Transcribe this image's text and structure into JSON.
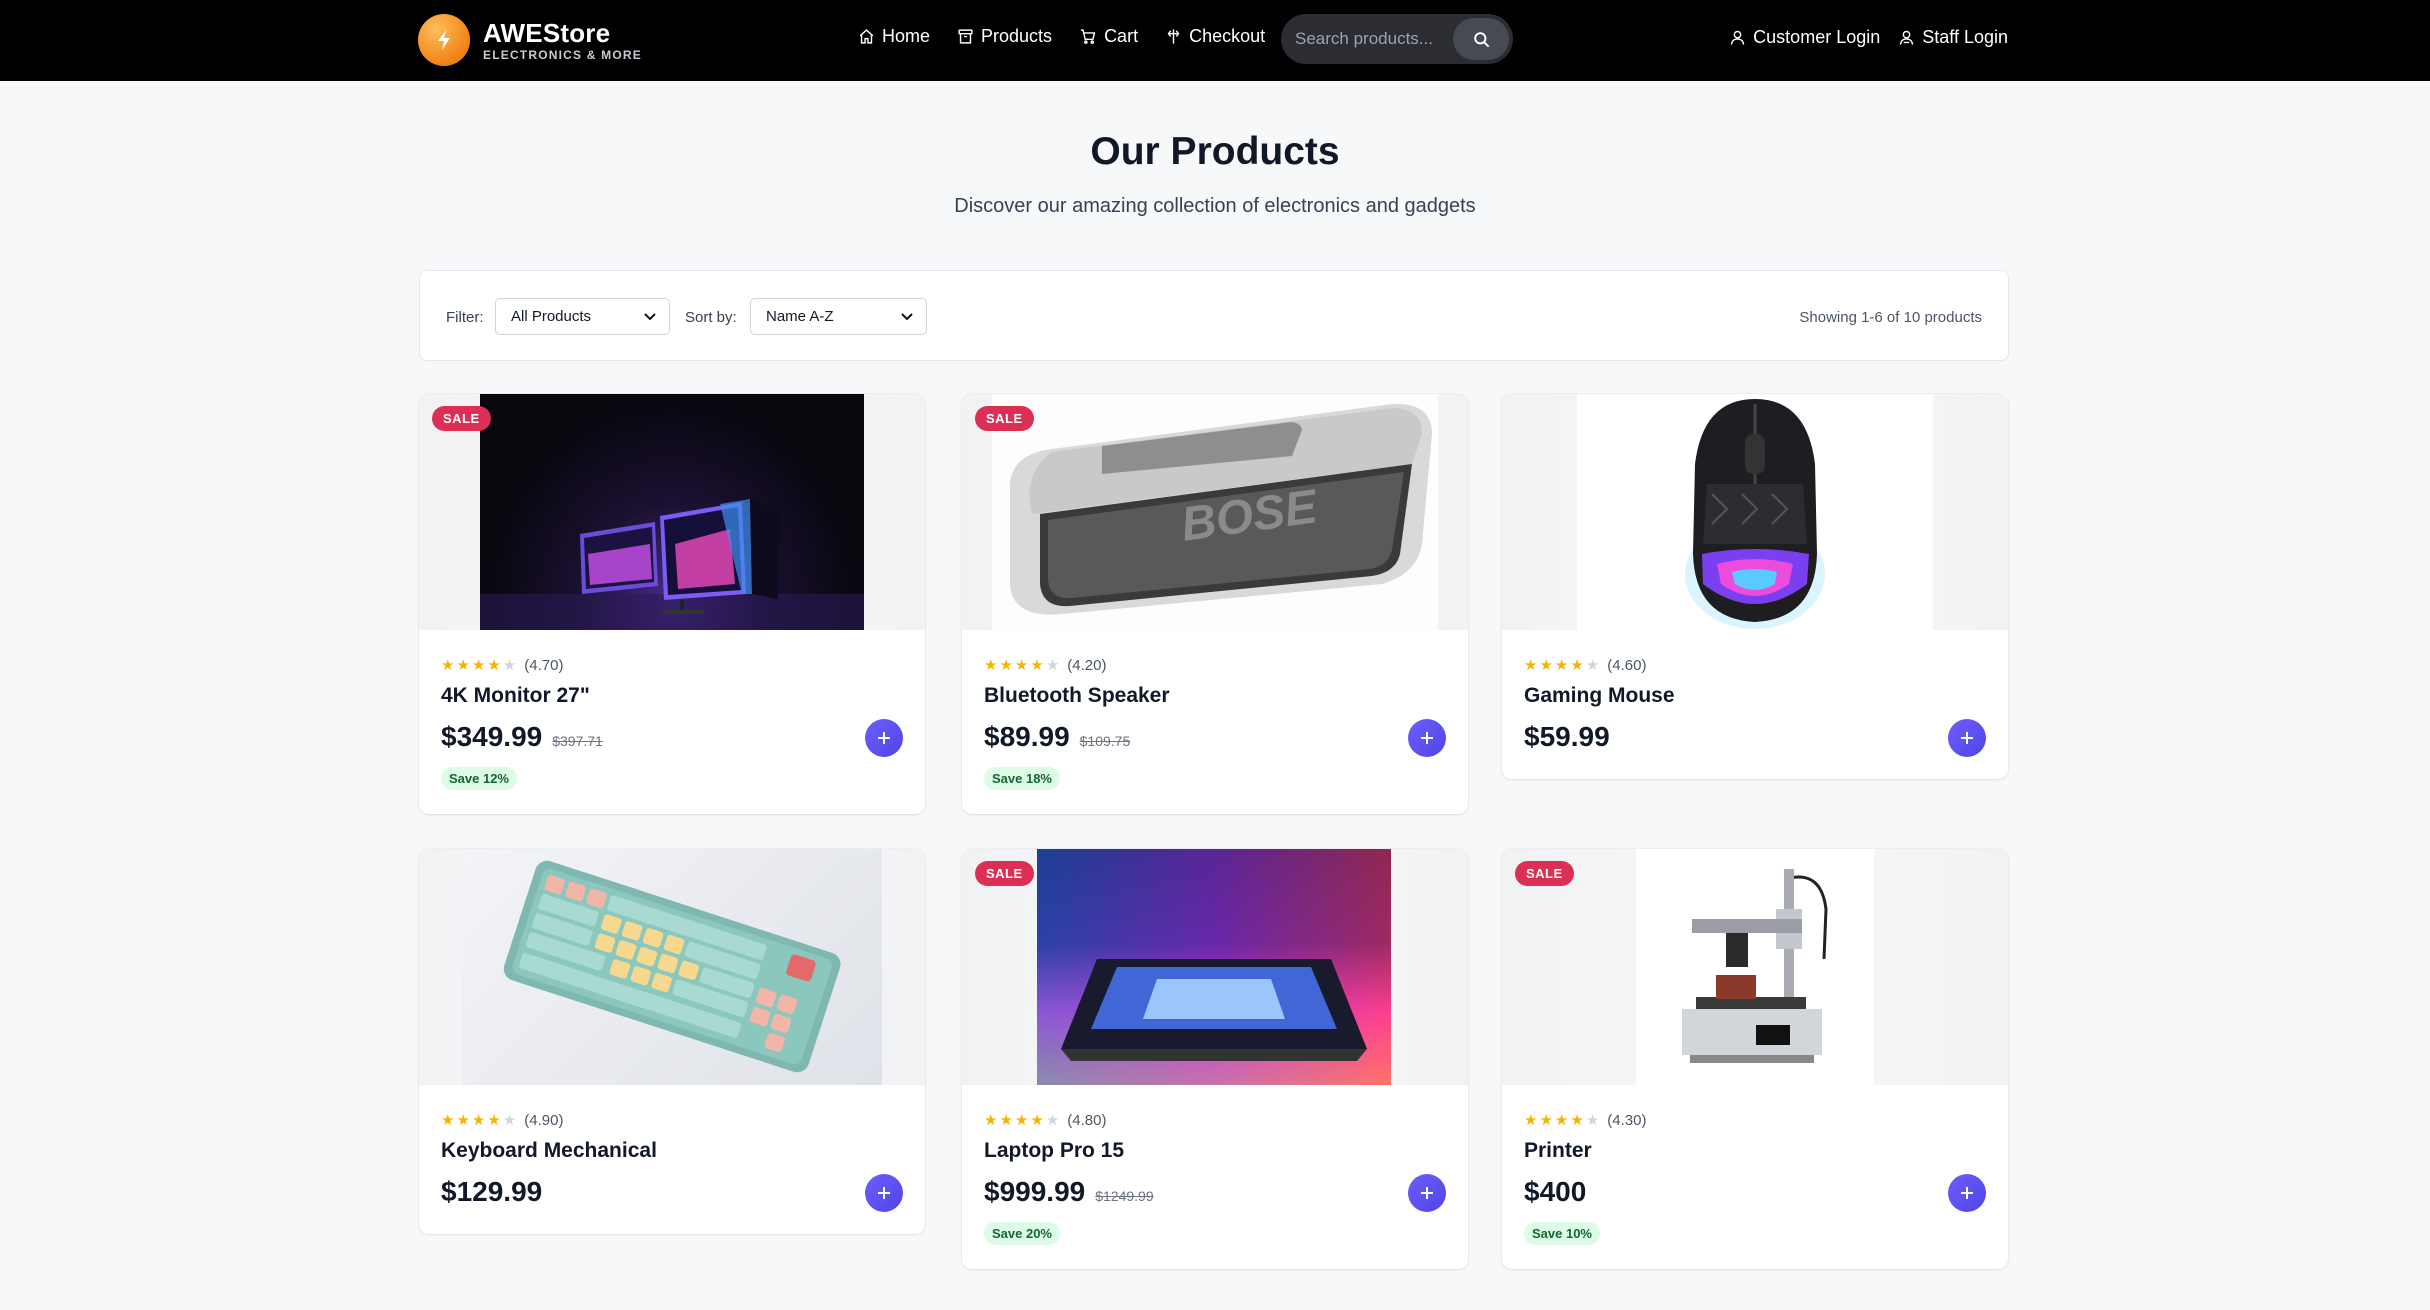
{
  "brand": {
    "name": "AWEStore",
    "tagline": "ELECTRONICS & MORE"
  },
  "nav": {
    "home": "Home",
    "products": "Products",
    "cart": "Cart",
    "checkout": "Checkout"
  },
  "search": {
    "placeholder": "Search products..."
  },
  "auth": {
    "customer_login": "Customer Login",
    "staff_login": "Staff Login"
  },
  "page": {
    "title": "Our Products",
    "subtitle": "Discover our amazing collection of electronics and gadgets"
  },
  "filters": {
    "filter_label": "Filter:",
    "filter_value": "All Products",
    "sort_label": "Sort by:",
    "sort_value": "Name A-Z",
    "showing": "Showing 1-6 of 10 products"
  },
  "colors": {
    "accent": "#5b4ff0",
    "sale": "#dc2f55",
    "save_bg": "#dcfce7",
    "star": "#f5b400",
    "nav_bg": "#000000"
  },
  "products": [
    {
      "name": "4K Monitor 27\"",
      "rating": "(4.70)",
      "stars": 4,
      "price": "$349.99",
      "old_price": "$397.71",
      "save": "Save 12%",
      "sale": "SALE"
    },
    {
      "name": "Bluetooth Speaker",
      "rating": "(4.20)",
      "stars": 4,
      "price": "$89.99",
      "old_price": "$109.75",
      "save": "Save 18%",
      "sale": "SALE"
    },
    {
      "name": "Gaming Mouse",
      "rating": "(4.60)",
      "stars": 4,
      "price": "$59.99"
    },
    {
      "name": "Keyboard Mechanical",
      "rating": "(4.90)",
      "stars": 4,
      "price": "$129.99"
    },
    {
      "name": "Laptop Pro 15",
      "rating": "(4.80)",
      "stars": 4,
      "price": "$999.99",
      "old_price": "$1249.99",
      "save": "Save 20%",
      "sale": "SALE"
    },
    {
      "name": "Printer",
      "rating": "(4.30)",
      "stars": 4,
      "price": "$400",
      "save": "Save 10%",
      "sale": "SALE"
    }
  ]
}
